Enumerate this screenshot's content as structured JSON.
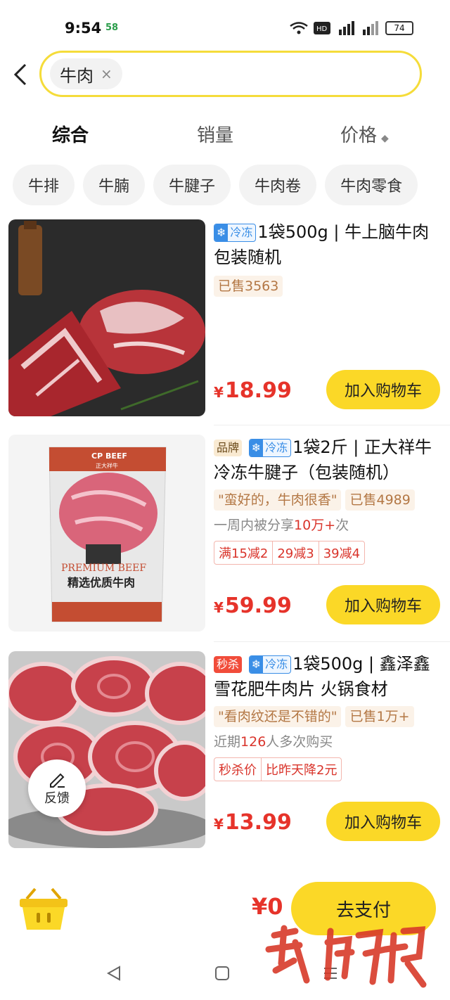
{
  "status": {
    "time": "9:54",
    "net": "58",
    "battery": "74"
  },
  "search": {
    "chip": "牛肉",
    "clear": "×"
  },
  "sort_tabs": [
    "综合",
    "销量",
    "价格"
  ],
  "filters": [
    "牛排",
    "牛腩",
    "牛腱子",
    "牛肉卷",
    "牛肉零食"
  ],
  "tag_labels": {
    "frozen": "冷冻",
    "brand": "品牌",
    "flash": "秒杀"
  },
  "products": [
    {
      "title": "1袋500g | 牛上脑牛肉包装随机",
      "sold": "已售3563",
      "currency": "¥",
      "price": "18.99",
      "cart": "加入购物车"
    },
    {
      "title": "1袋2斤 | 正大祥牛冷冻牛腱子（包装随机）",
      "review": "\"蛮好的，牛肉很香\"",
      "sold": "已售4989",
      "share_prefix": "一周内被分享",
      "share_count": "10万+",
      "share_suffix": "次",
      "promos": [
        "满15减2",
        "29减3",
        "39减4"
      ],
      "bag_brand": "CP BEEF",
      "bag_sub": "正大祥牛",
      "bag_premium": "PREMIUM BEEF",
      "bag_cn": "精选优质牛肉",
      "currency": "¥",
      "price": "59.99",
      "cart": "加入购物车"
    },
    {
      "title": "1袋500g | 鑫泽鑫 雪花肥牛肉片 火锅食材",
      "review": "\"看肉纹还是不错的\"",
      "sold": "已售1万+",
      "repeat_prefix": "近期",
      "repeat_count": "126",
      "repeat_suffix": "人多次购买",
      "flash_promo": [
        "秒杀价",
        "比昨天降2元"
      ],
      "currency": "¥",
      "price": "13.99",
      "cart": "加入购物车"
    }
  ],
  "feedback": "反馈",
  "bottom": {
    "total": "¥0",
    "pay": "去支付"
  },
  "watermark": "新晚报",
  "colors": {
    "accent": "#fbd827",
    "price": "#e6332a",
    "frozen": "#3a8ee6"
  }
}
